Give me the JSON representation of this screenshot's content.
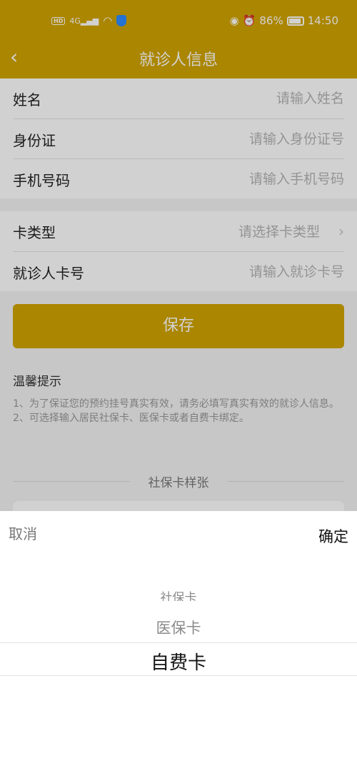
{
  "status_bar": {
    "network_text": "4G",
    "battery": "86%",
    "time": "14:50",
    "icons": [
      "hd-icon",
      "signal-icon",
      "wifi-icon",
      "shield-icon",
      "eye-icon",
      "alarm-icon",
      "battery-icon"
    ]
  },
  "nav": {
    "title": "就诊人信息",
    "back_icon": "‹"
  },
  "form": {
    "name": {
      "label": "姓名",
      "placeholder": "请输入姓名"
    },
    "id_card": {
      "label": "身份证",
      "placeholder": "请输入身份证号"
    },
    "phone": {
      "label": "手机号码",
      "placeholder": "请输入手机号码"
    },
    "card_type": {
      "label": "卡类型",
      "placeholder": "请选择卡类型"
    },
    "card_no": {
      "label": "就诊人卡号",
      "placeholder": "请输入就诊卡号"
    }
  },
  "save_label": "保存",
  "tips": {
    "title": "温馨提示",
    "line1": "1、为了保证您的预约挂号真实有效，请务必填写真实有效的就诊人信息。",
    "line2": "2、可选择输入居民社保卡、医保卡或者自费卡绑定。"
  },
  "sample_title": "社保卡样张",
  "picker": {
    "cancel": "取消",
    "confirm": "确定",
    "options": [
      "社保卡",
      "医保卡",
      "自费卡"
    ],
    "selected": "自费卡"
  }
}
